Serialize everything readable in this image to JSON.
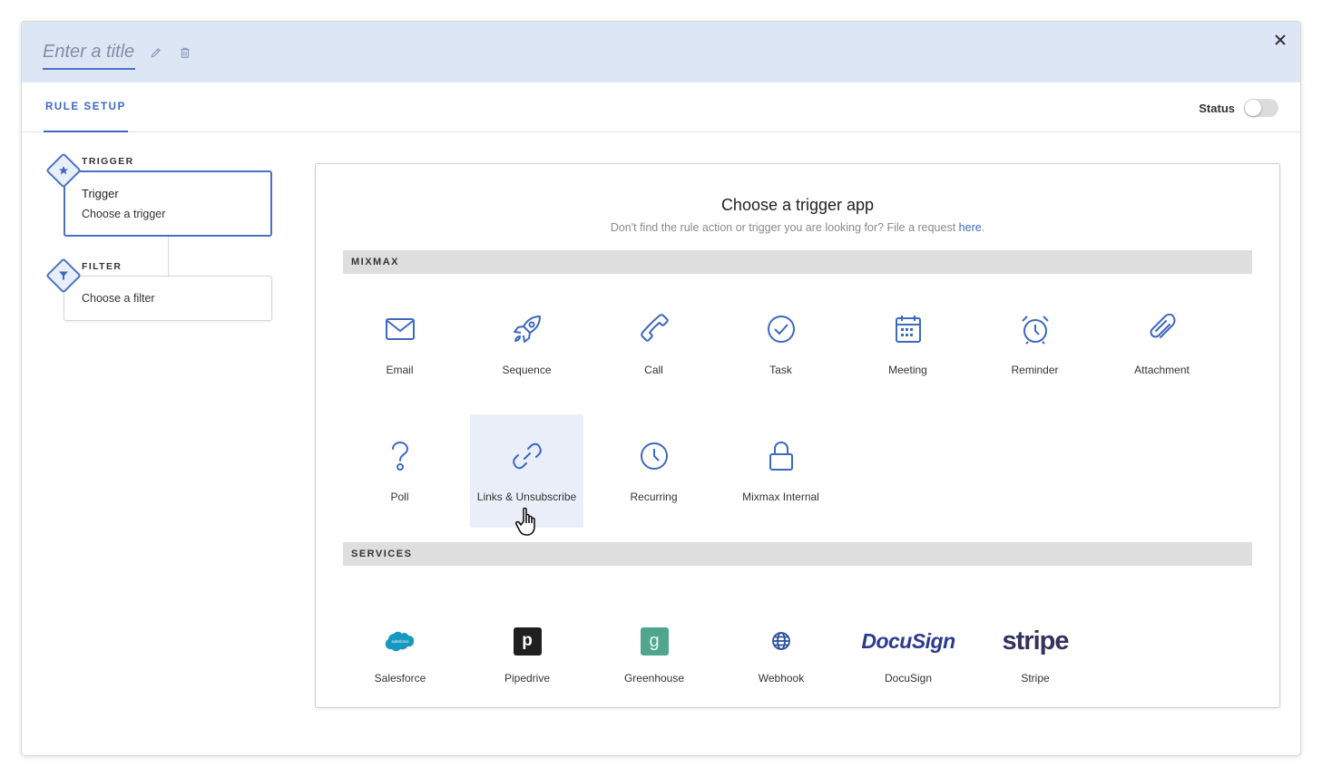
{
  "header": {
    "title_placeholder": "Enter a title",
    "edit_icon": "pencil-icon",
    "delete_icon": "trash-icon",
    "close_icon": "close-icon"
  },
  "tabs": [
    {
      "label": "RULE SETUP",
      "active": true
    }
  ],
  "status": {
    "label": "Status",
    "enabled": false
  },
  "steps": {
    "trigger": {
      "label": "TRIGGER",
      "title": "Trigger",
      "subtitle": "Choose a trigger",
      "icon": "star-icon"
    },
    "filter": {
      "label": "FILTER",
      "subtitle": "Choose a filter",
      "icon": "funnel-icon"
    }
  },
  "panel": {
    "title": "Choose a trigger app",
    "subtitle": "Don't find the rule action or trigger you are looking for? File a request ",
    "link_text": "here",
    "subtitle_end": "."
  },
  "sections": {
    "mixmax": {
      "label": "MIXMAX",
      "apps": [
        {
          "label": "Email",
          "icon": "envelope-icon"
        },
        {
          "label": "Sequence",
          "icon": "rocket-icon"
        },
        {
          "label": "Call",
          "icon": "phone-icon"
        },
        {
          "label": "Task",
          "icon": "check-circle-icon"
        },
        {
          "label": "Meeting",
          "icon": "calendar-icon"
        },
        {
          "label": "Reminder",
          "icon": "alarm-clock-icon"
        },
        {
          "label": "Attachment",
          "icon": "paperclip-icon"
        },
        {
          "label": "Poll",
          "icon": "question-icon"
        },
        {
          "label": "Links & Unsubscribe",
          "icon": "link-icon"
        },
        {
          "label": "Recurring",
          "icon": "clock-icon"
        },
        {
          "label": "Mixmax Internal",
          "icon": "lock-icon"
        }
      ]
    },
    "services": {
      "label": "SERVICES",
      "apps": [
        {
          "label": "Salesforce",
          "icon": "salesforce-logo",
          "logo_text": "salesforce"
        },
        {
          "label": "Pipedrive",
          "icon": "pipedrive-logo",
          "logo_text": "p"
        },
        {
          "label": "Greenhouse",
          "icon": "greenhouse-logo",
          "logo_text": "g"
        },
        {
          "label": "Webhook",
          "icon": "globe-icon"
        },
        {
          "label": "DocuSign",
          "icon": "docusign-logo",
          "logo_text": "DocuSign"
        },
        {
          "label": "Stripe",
          "icon": "stripe-logo",
          "logo_text": "stripe"
        }
      ]
    }
  },
  "colors": {
    "accent": "#3c68c0",
    "header_bg": "#dde6f5",
    "hover_bg": "#e9eef9",
    "greenhouse": "#4fa68b",
    "salesforce": "#1798c1",
    "stripe": "#32325d"
  }
}
